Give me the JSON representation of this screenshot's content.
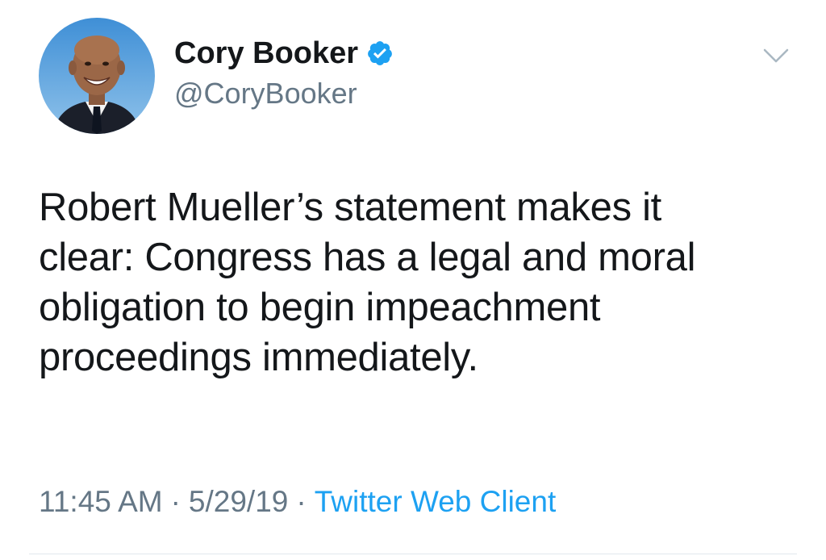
{
  "tweet": {
    "author": {
      "display_name": "Cory Booker",
      "handle": "@CoryBooker",
      "verified": true,
      "avatar_icon": "profile-photo",
      "verified_icon": "verified-badge-icon"
    },
    "menu_icon": "chevron-down-icon",
    "text_lines": [
      "Robert Mueller’s statement makes it",
      "clear: Congress has a legal and moral",
      "obligation to begin impeachment",
      "proceedings immediately."
    ],
    "meta": {
      "time": "11:45 AM",
      "separator": "·",
      "date": "5/29/19",
      "client": "Twitter Web Client"
    }
  },
  "colors": {
    "text": "#14171a",
    "secondary": "#657786",
    "link": "#1da1f2",
    "verified": "#1da1f2",
    "divider": "#e1e8ed"
  }
}
